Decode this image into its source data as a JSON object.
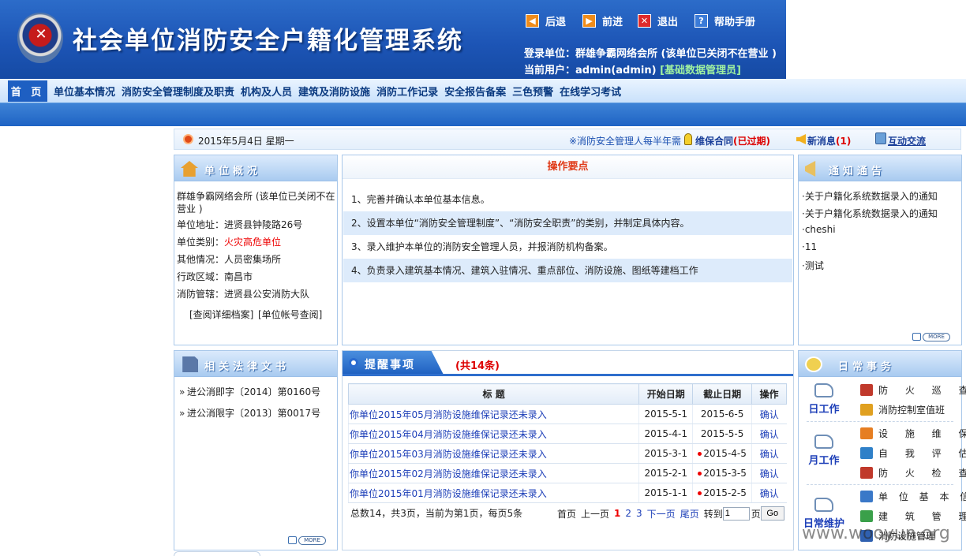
{
  "header": {
    "system_title": "社会单位消防安全户籍化管理系统",
    "buttons": [
      {
        "label": "后退",
        "icon": "back-arrow-icon",
        "color": "#f08c1a"
      },
      {
        "label": "前进",
        "icon": "forward-arrow-icon",
        "color": "#f08c1a"
      },
      {
        "label": "退出",
        "icon": "close-icon",
        "color": "#e02a2a"
      },
      {
        "label": "帮助手册",
        "icon": "help-icon",
        "color": "#3b7bd8"
      }
    ],
    "login_unit": "登录单位：群雄争霸网络会所 (该单位已关闭不在营业 )",
    "current_user": "当前用户：admin(admin)",
    "current_role": "[基础数据管理员]"
  },
  "nav": {
    "home": "首 页",
    "items": [
      "单位基本情况",
      "消防安全管理制度及职责",
      "机构及人员",
      "建筑及消防设施",
      "消防工作记录",
      "安全报告备案",
      "三色预警",
      "在线学习考试"
    ]
  },
  "datebar": {
    "date": "2015年5月4日 星期一",
    "marquee": "※消防安全管理人每半年需",
    "contract": "维保合同",
    "contract_status": "(已过期)",
    "news": "新消息",
    "news_count": "(1)",
    "chat": "互动交流"
  },
  "unit_panel": {
    "title": "单位概况",
    "name": "群雄争霸网络会所 (该单位已关闭不在",
    "name2": "营业 )",
    "address": "单位地址：进贤县钟陵路26号",
    "category_label": "单位类别：",
    "category_value": "火灾高危单位",
    "other": "其他情况：人员密集场所",
    "region": "行政区域：南昌市",
    "jurisdiction": "消防管辖：进贤县公安消防大队",
    "link_archive": "[查阅详细档案]",
    "link_account": "[单位帐号查阅]"
  },
  "ops_panel": {
    "title": "操作要点",
    "items": [
      "1、完善并确认本单位基本信息。",
      "2、设置本单位“消防安全管理制度”、“消防安全职责”的类别，并制定具体内容。",
      "3、录入维护本单位的消防安全管理人员，并报消防机构备案。",
      "4、负责录入建筑基本情况、建筑入驻情况、重点部位、消防设施、图纸等建档工作"
    ]
  },
  "notice_panel": {
    "title": "通知通告",
    "items": [
      "·关于户籍化系统数据录入的通知",
      "·关于户籍化系统数据录入的通知",
      "·cheshi",
      "·11",
      "·测试"
    ],
    "more": "MORE"
  },
  "laws_panel": {
    "title": "相关法律文书",
    "items": [
      "进公消即字〔2014〕第0160号",
      "进公消限字〔2013〕第0017号"
    ],
    "more": "MORE"
  },
  "reminders": {
    "tab": "提醒事项",
    "count": "(共14条)",
    "columns": [
      "标 题",
      "开始日期",
      "截止日期",
      "操作"
    ],
    "rows": [
      {
        "title": "你单位2015年05月消防设施维保记录还未录入",
        "start": "2015-5-1",
        "end": "2015-6-5",
        "overdue": false,
        "action": "确认"
      },
      {
        "title": "你单位2015年04月消防设施维保记录还未录入",
        "start": "2015-4-1",
        "end": "2015-5-5",
        "overdue": false,
        "action": "确认"
      },
      {
        "title": "你单位2015年03月消防设施维保记录还未录入",
        "start": "2015-3-1",
        "end": "2015-4-5",
        "overdue": true,
        "action": "确认"
      },
      {
        "title": "你单位2015年02月消防设施维保记录还未录入",
        "start": "2015-2-1",
        "end": "2015-3-5",
        "overdue": true,
        "action": "确认"
      },
      {
        "title": "你单位2015年01月消防设施维保记录还未录入",
        "start": "2015-1-1",
        "end": "2015-2-5",
        "overdue": true,
        "action": "确认"
      }
    ],
    "summary": "总数14，共3页，当前为第1页，每页5条",
    "pager": {
      "first": "首页",
      "prev": "上一页",
      "pages": [
        "1",
        "2",
        "3"
      ],
      "next": "下一页",
      "last": "尾页",
      "goto": "转到",
      "input_value": "1",
      "page_unit": "页",
      "go": "Go"
    }
  },
  "daily_panel": {
    "title": "日常事务",
    "groups": [
      {
        "label": "日工作",
        "items": [
          {
            "text": "防 火 巡 查",
            "icon": "patrol-icon",
            "color": "#c0392b"
          },
          {
            "text": "消防控制室值班",
            "icon": "control-room-icon",
            "color": "#e0a020"
          }
        ]
      },
      {
        "label": "月工作",
        "items": [
          {
            "text": "设 施 维 保",
            "icon": "tools-icon",
            "color": "#e67e22"
          },
          {
            "text": "自 我 评 估",
            "icon": "users-icon",
            "color": "#2f80c8"
          },
          {
            "text": "防 火 检 查",
            "icon": "extinguisher-icon",
            "color": "#c0392b"
          }
        ]
      },
      {
        "label": "日常维护",
        "items": [
          {
            "text": "单 位 基 本 信 息",
            "icon": "info-chart-icon",
            "color": "#3a78c8"
          },
          {
            "text": "建 筑 管 理",
            "icon": "building-chart-icon",
            "color": "#3aa04a"
          },
          {
            "text": "消防设施管理",
            "icon": "facility-icon",
            "color": "#2f60b0"
          }
        ]
      }
    ]
  },
  "watermark": "www.wooyun.org"
}
